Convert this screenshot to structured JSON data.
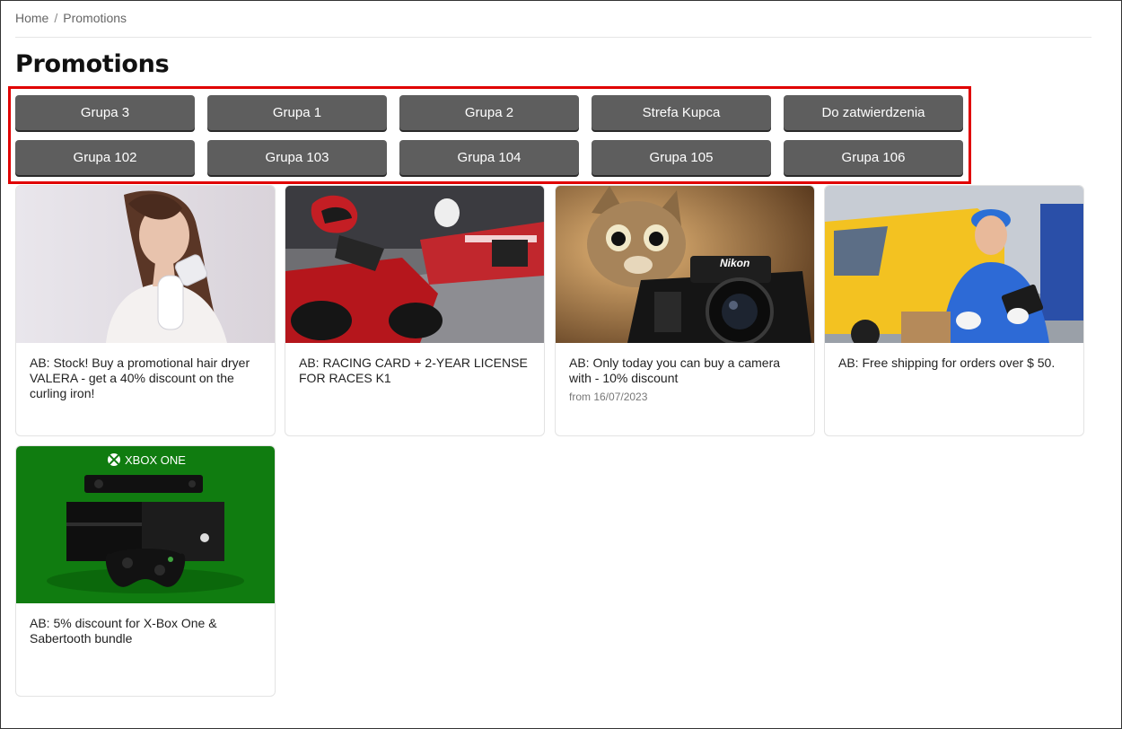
{
  "breadcrumb": {
    "home": "Home",
    "separator": "/",
    "current": "Promotions"
  },
  "page": {
    "title": "Promotions"
  },
  "groups": [
    {
      "label": "Grupa 3"
    },
    {
      "label": "Grupa 1"
    },
    {
      "label": "Grupa 2"
    },
    {
      "label": "Strefa Kupca"
    },
    {
      "label": "Do zatwierdzenia"
    },
    {
      "label": "Grupa 102"
    },
    {
      "label": "Grupa 103"
    },
    {
      "label": "Grupa 104"
    },
    {
      "label": "Grupa 105"
    },
    {
      "label": "Grupa 106"
    }
  ],
  "promotions": [
    {
      "title": "AB: Stock! Buy a promotional hair dryer VALERA - get a 40% discount on the curling iron!",
      "date": ""
    },
    {
      "title": "AB: RACING CARD + 2-YEAR LICENSE FOR RACES K1",
      "date": ""
    },
    {
      "title": "AB: Only today you can buy a camera with - 10% discount",
      "date": "from 16/07/2023",
      "brand_text": "Nikon"
    },
    {
      "title": "AB: Free shipping for orders over $ 50.",
      "date": ""
    },
    {
      "title": "AB: 5% discount for X-Box One & Sabertooth bundle",
      "date": "",
      "brand_text": "XBOX ONE"
    }
  ],
  "colors": {
    "button": "#5e5e5e",
    "highlight": "#e00000",
    "xbox_green": "#107c10"
  }
}
